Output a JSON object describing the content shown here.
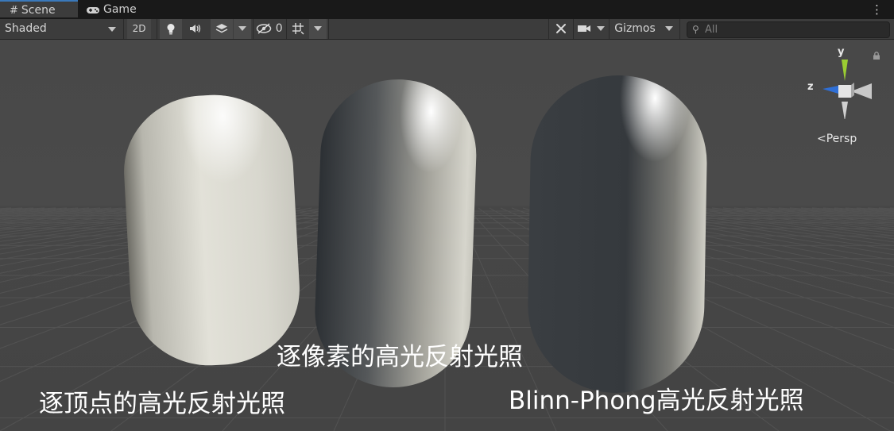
{
  "tabs": [
    {
      "label": "Scene",
      "icon": "grid-icon",
      "active": true
    },
    {
      "label": "Game",
      "icon": "gamepad-icon",
      "active": false
    }
  ],
  "toolbar": {
    "draw_mode": "Shaded",
    "mode_2d": "2D",
    "hidden_count": "0",
    "gizmos": "Gizmos",
    "search_placeholder": "All"
  },
  "gizmo": {
    "y_label": "y",
    "z_label": "z",
    "projection": "Persp"
  },
  "captions": {
    "left": "逐顶点的高光反射光照",
    "middle": "逐像素的高光反射光照",
    "right": "Blinn-Phong高光反射光照"
  },
  "colors": {
    "background_dark": "#1e1e1e",
    "toolbar": "#3c3c3c",
    "viewport": "#474747",
    "accent_tab": "#3a79bb",
    "gizmo_y": "#9acd32",
    "gizmo_z": "#2f6fd6"
  }
}
